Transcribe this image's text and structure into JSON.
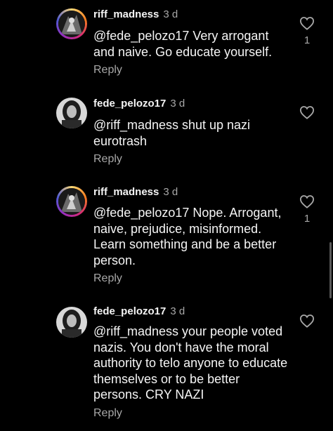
{
  "comments": [
    {
      "username": "riff_madness",
      "time": "3 d",
      "text": "@fede_pelozo17 Very arrogant and naive. Go educate yourself.",
      "reply_label": "Reply",
      "likes": "1",
      "avatar": "gradient-ring"
    },
    {
      "username": "fede_pelozo17",
      "time": "3 d",
      "text": "@riff_madness shut up nazi eurotrash",
      "reply_label": "Reply",
      "likes": "",
      "avatar": "plain"
    },
    {
      "username": "riff_madness",
      "time": "3 d",
      "text": "@fede_pelozo17 Nope. Arrogant, naive, prejudice, misinformed. Learn something and be a better person.",
      "reply_label": "Reply",
      "likes": "1",
      "avatar": "gradient-ring"
    },
    {
      "username": "fede_pelozo17",
      "time": "3 d",
      "text": "@riff_madness your people voted nazis. You don't have the moral authority to telo anyone to educate themselves or to be better persons. CRY NAZI",
      "reply_label": "Reply",
      "likes": "",
      "avatar": "plain"
    }
  ],
  "icons": {
    "like": "heart-outline-icon"
  },
  "colors": {
    "background": "#000000",
    "primary_text": "#f5f5f5",
    "secondary_text": "#a8a8a8"
  }
}
